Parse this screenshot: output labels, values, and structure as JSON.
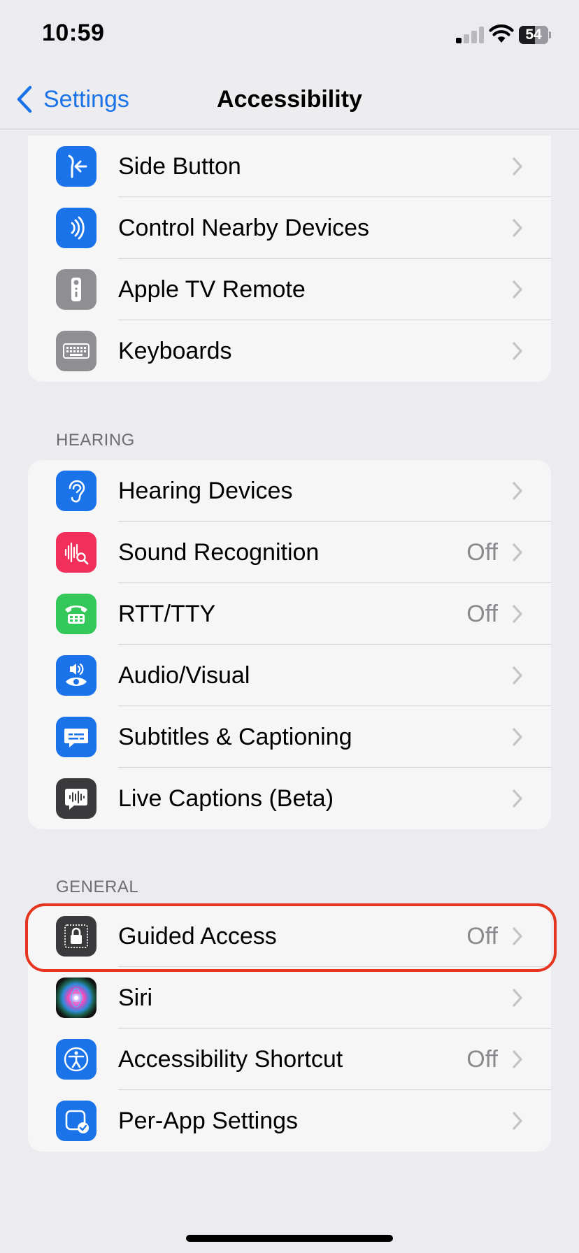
{
  "status_bar": {
    "time": "10:59",
    "battery": "54"
  },
  "nav": {
    "back_label": "Settings",
    "title": "Accessibility"
  },
  "group_top": {
    "items": [
      {
        "label": "Side Button",
        "icon": "side-button-icon",
        "color": "#1a73e8"
      },
      {
        "label": "Control Nearby Devices",
        "icon": "nearby-devices-icon",
        "color": "#1a73e8"
      },
      {
        "label": "Apple TV Remote",
        "icon": "tv-remote-icon",
        "color": "#8e8e93"
      },
      {
        "label": "Keyboards",
        "icon": "keyboard-icon",
        "color": "#8e8e93"
      }
    ]
  },
  "hearing": {
    "header": "HEARING",
    "items": [
      {
        "label": "Hearing Devices",
        "icon": "ear-icon",
        "color": "#1a73e8"
      },
      {
        "label": "Sound Recognition",
        "value": "Off",
        "icon": "sound-recognition-icon",
        "color": "#f0305a"
      },
      {
        "label": "RTT/TTY",
        "value": "Off",
        "icon": "tty-phone-icon",
        "color": "#34c759"
      },
      {
        "label": "Audio/Visual",
        "icon": "audio-visual-icon",
        "color": "#1a73e8"
      },
      {
        "label": "Subtitles & Captioning",
        "icon": "subtitles-icon",
        "color": "#1a73e8"
      },
      {
        "label": "Live Captions (Beta)",
        "icon": "live-captions-icon",
        "color": "#3a3a3c"
      }
    ]
  },
  "general": {
    "header": "GENERAL",
    "items": [
      {
        "label": "Guided Access",
        "value": "Off",
        "icon": "lock-icon",
        "color": "#3a3a3c"
      },
      {
        "label": "Siri",
        "icon": "siri-icon",
        "color": "#111"
      },
      {
        "label": "Accessibility Shortcut",
        "value": "Off",
        "icon": "accessibility-icon",
        "color": "#1a73e8"
      },
      {
        "label": "Per-App Settings",
        "icon": "per-app-icon",
        "color": "#1a73e8"
      }
    ]
  }
}
